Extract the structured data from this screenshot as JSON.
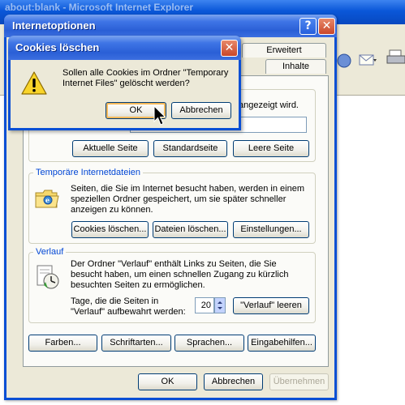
{
  "background_window": {
    "title": "about:blank - Microsoft Internet Explorer"
  },
  "dialog": {
    "title": "Internetoptionen",
    "help_label": "?",
    "close_label": "✕",
    "tabs": {
      "row1_visible": "Erweitert",
      "row2_visible": "Inhalte"
    },
    "homepage": {
      "partial_text": "angezeigt wird.",
      "buttons": {
        "current": "Aktuelle Seite",
        "default": "Standardseite",
        "blank": "Leere Seite"
      }
    },
    "temp_files": {
      "title": "Temporäre Internetdateien",
      "description": "Seiten, die Sie im Internet besucht haben, werden in einem speziellen Ordner gespeichert, um sie später schneller anzeigen zu können.",
      "buttons": {
        "cookies": "Cookies löschen...",
        "files": "Dateien löschen...",
        "settings": "Einstellungen..."
      }
    },
    "history": {
      "title": "Verlauf",
      "description": "Der Ordner \"Verlauf\" enthält Links zu Seiten, die Sie besucht haben, um einen schnellen Zugang zu kürzlich besuchten Seiten zu ermöglichen.",
      "days_label": "Tage, die die Seiten in \"Verlauf\" aufbewahrt werden:",
      "days_value": "20",
      "clear_button": "\"Verlauf\" leeren"
    },
    "bottom_buttons": {
      "colors": "Farben...",
      "fonts": "Schriftarten...",
      "languages": "Sprachen...",
      "accessibility": "Eingabehilfen..."
    },
    "footer": {
      "ok": "OK",
      "cancel": "Abbrechen",
      "apply": "Übernehmen"
    }
  },
  "confirm_popup": {
    "title": "Cookies löschen",
    "close_label": "✕",
    "message": "Sollen alle Cookies im Ordner \"Temporary Internet Files\" gelöscht werden?",
    "ok": "OK",
    "cancel": "Abbrechen"
  },
  "icons": {
    "warning": "warning-icon",
    "ie_folder": "ie-folder-icon",
    "history_clock": "history-clock-icon",
    "cursor": "mouse-cursor-icon"
  },
  "colors": {
    "title_blue": "#0a4fd4",
    "dialog_face": "#ece9d8",
    "group_title_blue": "#0046d5",
    "close_red": "#c9472a",
    "focus_orange": "#f5b95a"
  }
}
